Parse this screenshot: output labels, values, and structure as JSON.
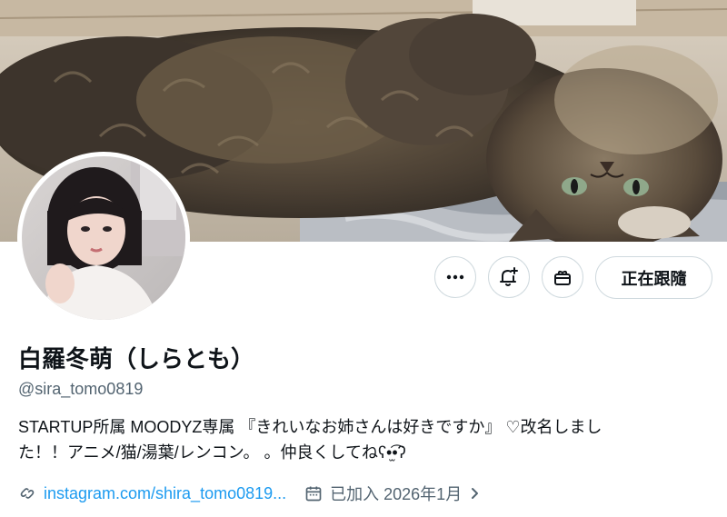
{
  "profile": {
    "display_name": "白羅冬萌（しらとも）",
    "handle": "@sira_tomo0819",
    "bio_line1": "STARTUP所属 MOODYZ専属 『きれいなお姉さんは好きですか』 ♡改名しまし",
    "bio_line2": "た！！アニメ/猫/湯葉/レンコン。 。仲良くしてねʕ•̫͡•ʔ",
    "link_text": "instagram.com/shira_tomo0819...",
    "joined_text": "已加入 2026年1月"
  },
  "actions": {
    "more_icon": "more-horizontal-icon",
    "notify_icon": "bell-plus-icon",
    "gift_icon": "gift-icon",
    "follow_label": "正在跟隨"
  },
  "colors": {
    "link": "#1d9bf0",
    "secondary_text": "#536471",
    "border": "#cfd9de",
    "text": "#0f1419"
  }
}
